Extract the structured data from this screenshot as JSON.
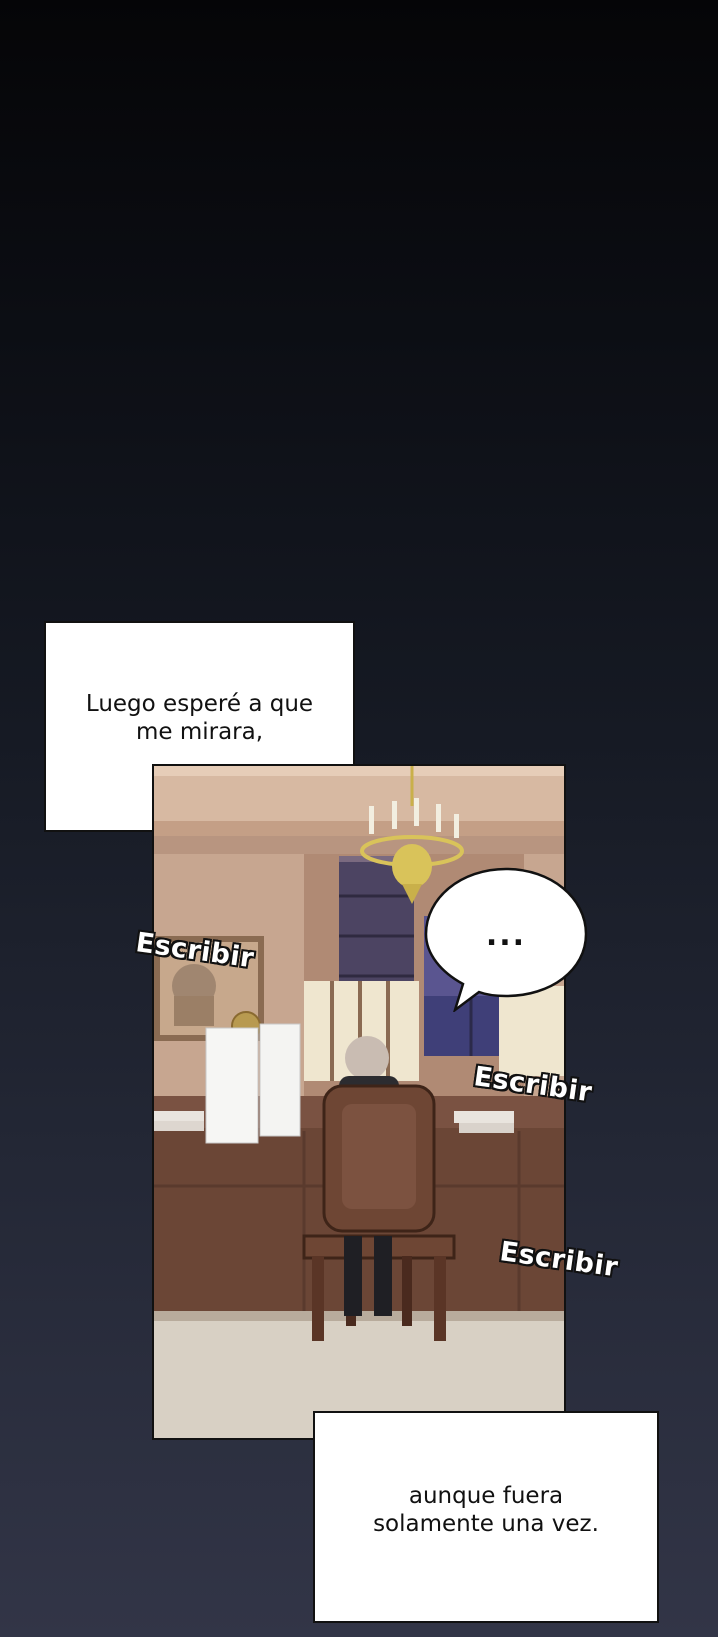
{
  "captions": {
    "top": "Luego esperé a que\nme mirara,",
    "bottom": "aunque fuera\nsolamente una vez."
  },
  "speech_bubble": {
    "text": "..."
  },
  "sound_effects": [
    "Escribir",
    "Escribir",
    "Escribir"
  ],
  "colors": {
    "background_top": "#050507",
    "background_bottom": "#323547",
    "wall": "#c9a893",
    "desk": "#6e4a3a",
    "floor": "#d8d0c4",
    "night_window": "#4a4a7a",
    "chandelier": "#d9c35a"
  },
  "illustration": {
    "scene": "office-with-man-writing-at-desk",
    "icons": [
      "chandelier-icon",
      "globe-icon",
      "paper-stack-icon",
      "chair-icon",
      "painting-icon"
    ]
  }
}
